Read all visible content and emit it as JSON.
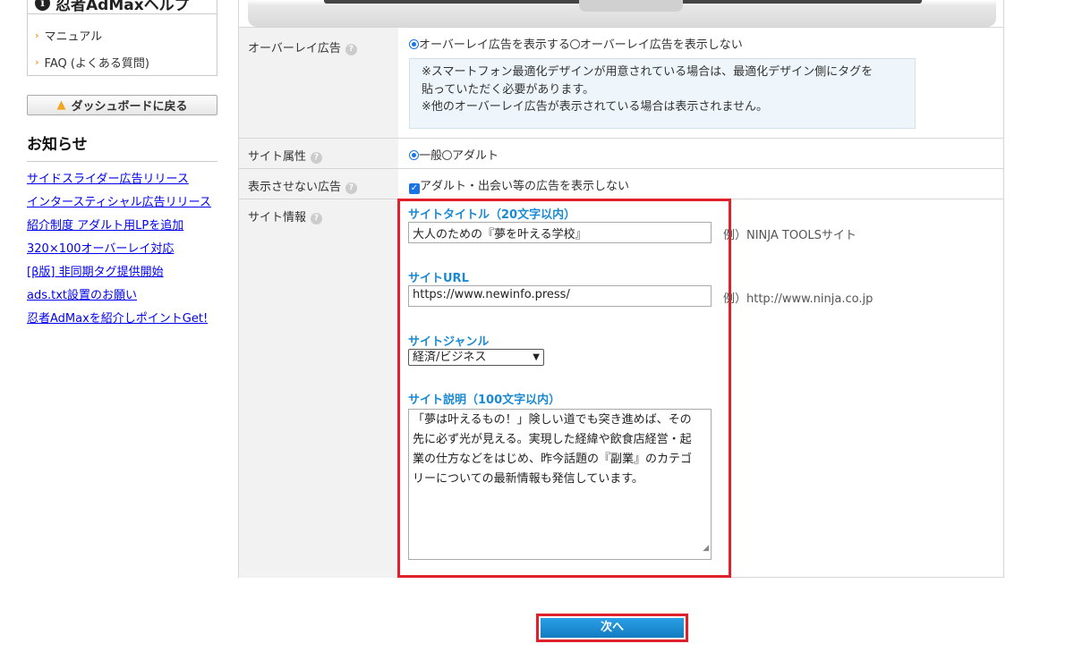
{
  "sidebar": {
    "help_title": "忍者AdMaxヘルプ",
    "help_items": [
      {
        "label": "マニュアル"
      },
      {
        "label": "FAQ (よくある質問)"
      }
    ],
    "dashboard_button": "ダッシュボードに戻る",
    "news_title": "お知らせ",
    "news": [
      {
        "label": "サイドスライダー広告リリース"
      },
      {
        "label": "インタースティシャル広告リリース"
      },
      {
        "label": "紹介制度 アダルト用LPを追加"
      },
      {
        "label": "320×100オーバーレイ対応"
      },
      {
        "label": "[β版] 非同期タグ提供開始"
      },
      {
        "label": "ads.txt設置のお願い"
      },
      {
        "label": "忍者AdMaxを紹介しポイントGet!"
      }
    ]
  },
  "form": {
    "overlay": {
      "label": "オーバーレイ広告",
      "option_show": "オーバーレイ広告を表示する",
      "option_hide": "オーバーレイ広告を表示しない",
      "selected": "show",
      "note_lines": [
        "※スマートフォン最適化デザインが用意されている場合は、最適化デザイン側にタグを",
        "貼っていただく必要があります。",
        "※他のオーバーレイ広告が表示されている場合は表示されません。"
      ]
    },
    "site_attr": {
      "label": "サイト属性",
      "option_general": "一般",
      "option_adult": "アダルト",
      "selected": "general"
    },
    "hidden_ads": {
      "label": "表示させない広告",
      "checkbox_label": "アダルト・出会い等の広告を表示しない",
      "checked": true
    },
    "site_info": {
      "label": "サイト情報",
      "title_label": "サイトタイトル（20文字以内）",
      "title_value": "大人のための『夢を叶える学校』",
      "title_example": "例）NINJA TOOLSサイト",
      "url_label": "サイトURL",
      "url_value": "https://www.newinfo.press/",
      "url_example": "例）http://www.ninja.co.jp",
      "genre_label": "サイトジャンル",
      "genre_value": "経済/ビジネス",
      "desc_label": "サイト説明（100文字以内）",
      "desc_lines": [
        "「夢は叶えるもの！」険しい道でも突き進めば、その",
        "先に必ず光が見える。実現した経緯や飲食店経営・起",
        "業の仕方などをはじめ、昨今話題の『副業』のカテゴ",
        "リーについての最新情報も発信しています。"
      ]
    }
  },
  "next_button": "次へ",
  "colors": {
    "link": "#0000ee",
    "field_label": "#1a8ad4",
    "highlight": "#e0202a",
    "primary_button": "#1a8ad4",
    "label_bg": "#f2f2f2",
    "note_bg": "#eef6fb"
  },
  "icons": {
    "help": "info-icon",
    "help_item": "chevron-right-icon",
    "dashboard": "home-icon",
    "field_help": "question-icon",
    "select": "chevron-down-icon",
    "resize": "resize-grip-icon"
  }
}
